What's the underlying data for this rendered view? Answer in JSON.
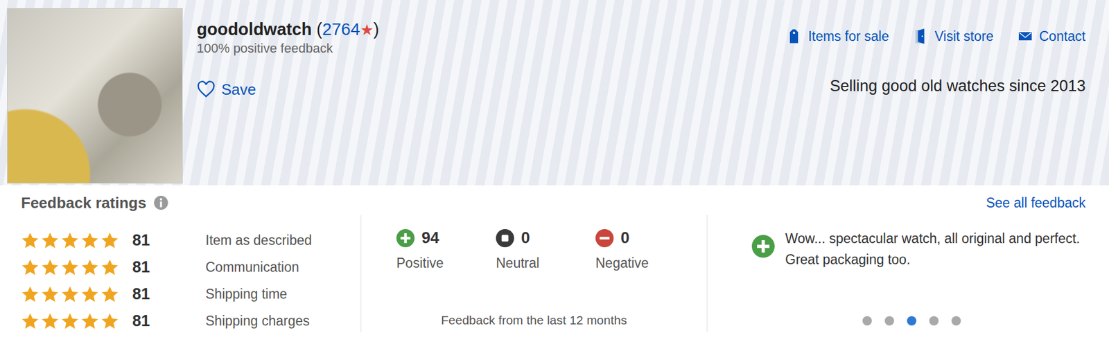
{
  "seller": {
    "username": "goodoldwatch",
    "open_paren": "(",
    "score": "2764",
    "score_star": "★",
    "close_paren": ")",
    "positive_percent": "100% positive feedback",
    "save": "Save",
    "tagline": "Selling good old watches since 2013"
  },
  "links": [
    {
      "label": "Items for sale",
      "kind": "tag"
    },
    {
      "label": "Visit store",
      "kind": "store"
    },
    {
      "label": "Contact",
      "kind": "mail"
    }
  ],
  "feedback_ratings": {
    "title": "Feedback ratings",
    "see_all": "See all feedback",
    "ratings": [
      {
        "label": "Item as described",
        "stars": 5,
        "count": "81"
      },
      {
        "label": "Communication",
        "stars": 5,
        "count": "81"
      },
      {
        "label": "Shipping time",
        "stars": 5,
        "count": "81"
      },
      {
        "label": "Shipping charges",
        "stars": 5,
        "count": "81"
      }
    ]
  },
  "counts": [
    {
      "label": "Positive",
      "value": "94",
      "kind": "positive",
      "color": "#4a9e47"
    },
    {
      "label": "Neutral",
      "value": "0",
      "kind": "neutral",
      "color": "#3a3a3a"
    },
    {
      "label": "Negative",
      "value": "0",
      "kind": "negative",
      "color": "#c9463d"
    }
  ],
  "period": "Feedback from the last 12 months",
  "recent": {
    "kind": "positive",
    "color": "#4a9e47",
    "text": "Wow... spectacular watch, all original and perfect. Great packaging too."
  },
  "carousel": [
    {
      "selected": false
    },
    {
      "selected": false
    },
    {
      "selected": true
    },
    {
      "selected": false
    },
    {
      "selected": false
    }
  ]
}
